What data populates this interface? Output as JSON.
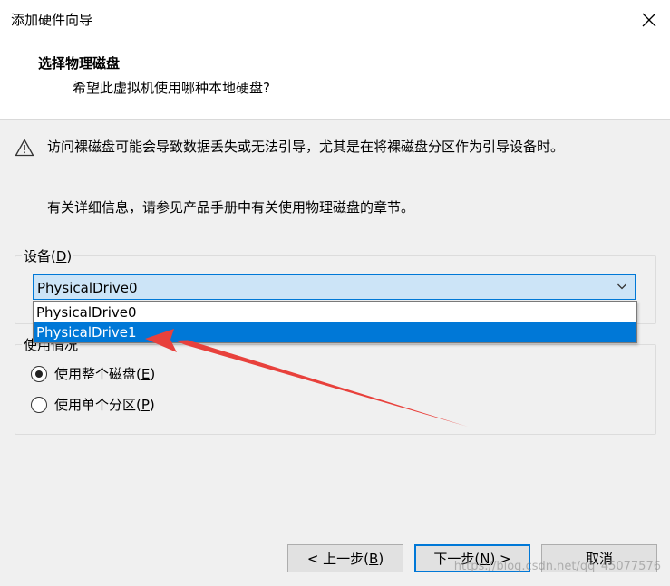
{
  "window": {
    "title": "添加硬件向导"
  },
  "header": {
    "title": "选择物理磁盘",
    "subtitle": "希望此虚拟机使用哪种本地硬盘?"
  },
  "warning": {
    "icon": "warning-triangle-icon",
    "text": "访问裸磁盘可能会导致数据丢失或无法引导，尤其是在将裸磁盘分区作为引导设备时。"
  },
  "info": {
    "text": "有关详细信息，请参见产品手册中有关使用物理磁盘的章节。"
  },
  "device": {
    "label_prefix": "设备(",
    "label_key": "D",
    "label_suffix": ")",
    "selected": "PhysicalDrive0",
    "options": [
      "PhysicalDrive0",
      "PhysicalDrive1"
    ],
    "highlighted": "PhysicalDrive1"
  },
  "usage": {
    "label": "使用情况",
    "options": [
      {
        "prefix": "使用整个磁盘(",
        "key": "E",
        "suffix": ")",
        "checked": true
      },
      {
        "prefix": "使用单个分区(",
        "key": "P",
        "suffix": ")",
        "checked": false
      }
    ]
  },
  "buttons": {
    "back_prefix": "< 上一步(",
    "back_key": "B",
    "back_suffix": ")",
    "next_prefix": "下一步(",
    "next_key": "N",
    "next_suffix": ") >",
    "cancel": "取消"
  },
  "watermark": "https://blog.csdn.net/qq_45077576",
  "colors": {
    "accent": "#0078d7",
    "combo_bg": "#cce4f7",
    "arrow": "#e8413c"
  }
}
